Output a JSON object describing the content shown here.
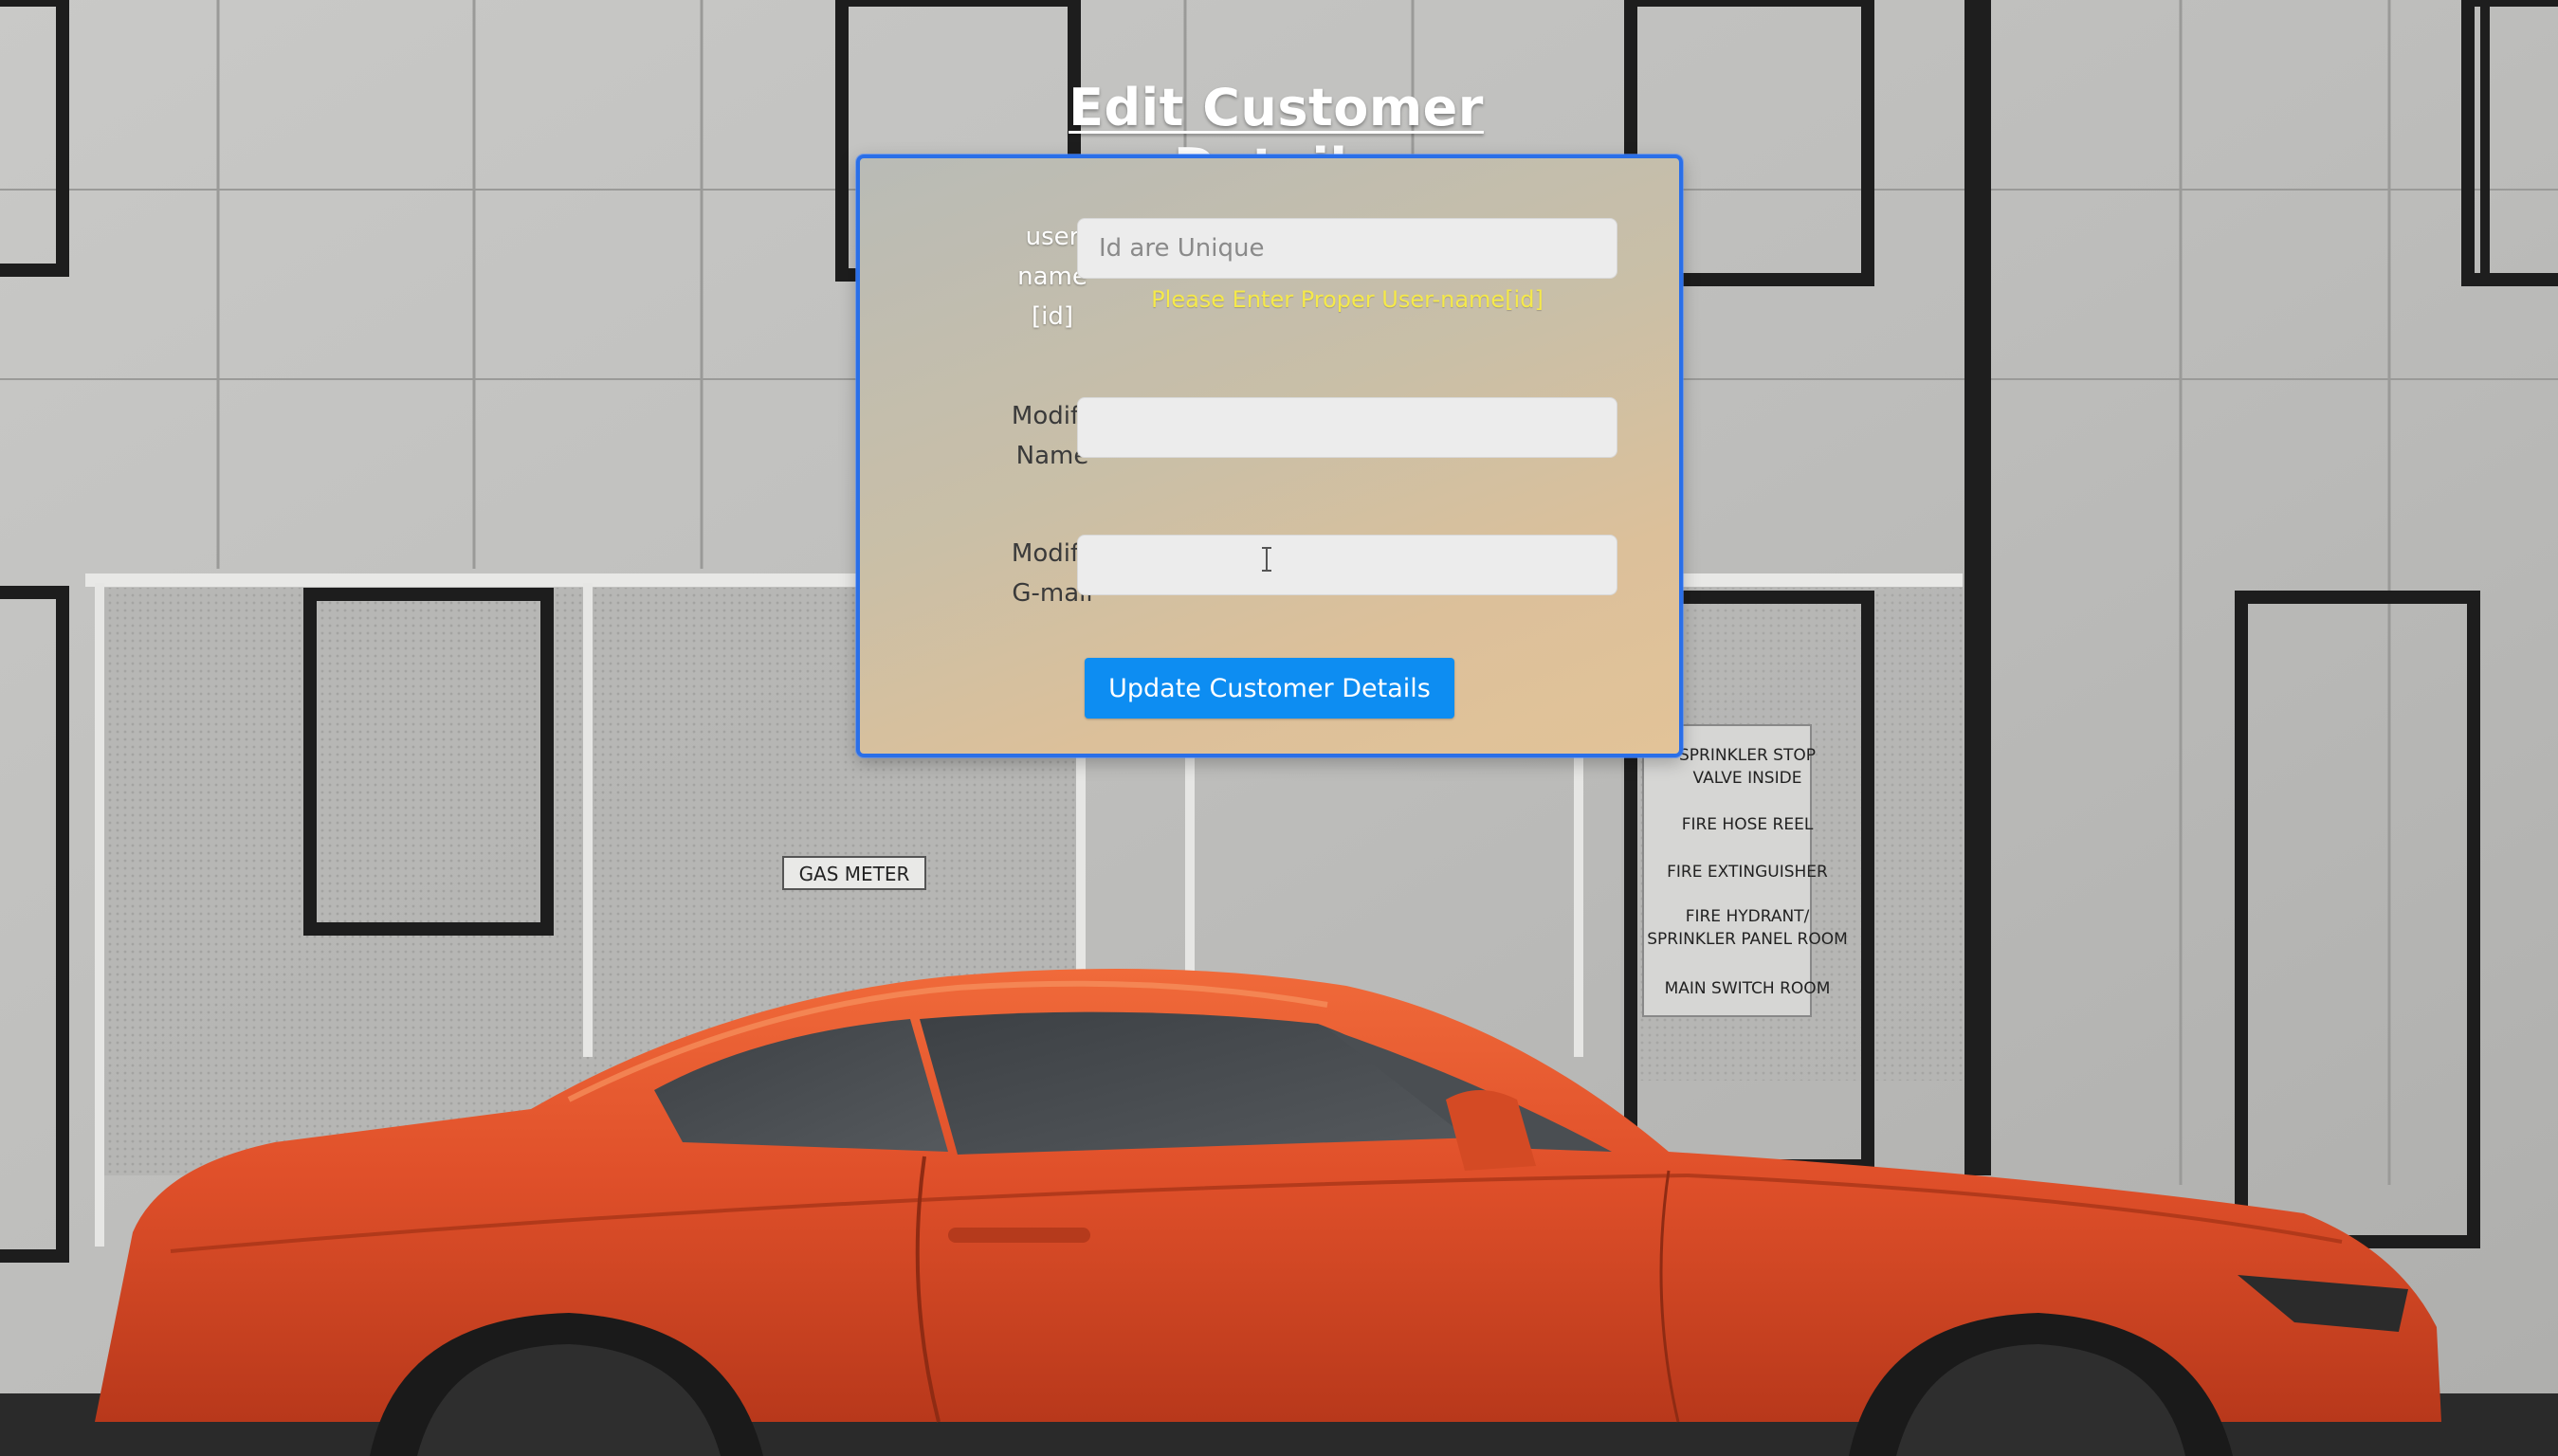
{
  "page": {
    "title": "Edit Customer Details"
  },
  "form": {
    "username_label": "user name [id]",
    "username_label_lines": [
      "user",
      "name",
      "[id]"
    ],
    "username_placeholder": "Id are Unique",
    "username_value": "",
    "username_error": "Please Enter Proper User-name[id]",
    "name_label_lines": [
      "Modify",
      "Name"
    ],
    "name_value": "",
    "email_label_lines": [
      "Modify",
      "G-mail"
    ],
    "email_value": "",
    "submit_label": "Update Customer Details"
  },
  "background": {
    "wall_signs": {
      "gas_meter": "GAS METER",
      "safety_lines": [
        "SPRINKLER STOP",
        "VALVE INSIDE",
        "FIRE HOSE REEL",
        "FIRE EXTINGUISHER",
        "FIRE HYDRANT/",
        "SPRINKLER PANEL ROOM",
        "MAIN SWITCH ROOM"
      ]
    }
  },
  "colors": {
    "panel_border": "#2a6fe8",
    "error_text": "#f5e94a",
    "button_bg": "#0d8df2",
    "car": "#e5532a"
  },
  "icons": {
    "text_cursor": "i-beam-cursor-icon"
  }
}
